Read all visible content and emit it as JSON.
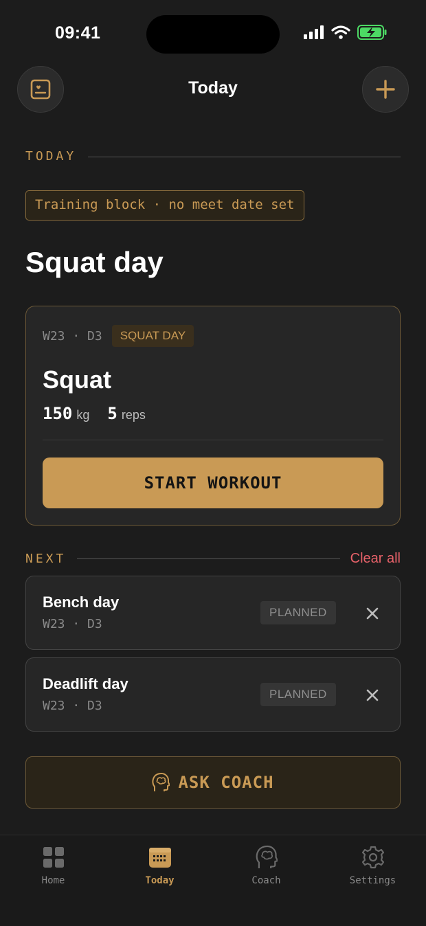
{
  "status_bar": {
    "time": "09:41"
  },
  "nav": {
    "title": "Today",
    "left_icon": "journal-icon",
    "right_icon": "plus-icon"
  },
  "today_section": {
    "label": "TODAY",
    "block_tag": "Training block · no meet date set",
    "day_title": "Squat day"
  },
  "workout_card": {
    "meta": "W23 · D3",
    "badge": "SQUAT DAY",
    "lift": "Squat",
    "weight": "150",
    "weight_unit": "kg",
    "reps": "5",
    "reps_unit": "reps",
    "start_label": "START WORKOUT"
  },
  "next_section": {
    "label": "NEXT",
    "clear_label": "Clear all",
    "items": [
      {
        "name": "Bench day",
        "meta": "W23 · D3",
        "status": "PLANNED"
      },
      {
        "name": "Deadlift day",
        "meta": "W23 · D3",
        "status": "PLANNED"
      }
    ]
  },
  "coach_button": {
    "label": "ASK COACH",
    "icon": "brain-head-icon"
  },
  "tab_bar": {
    "tabs": [
      {
        "label": "Home",
        "icon": "grid-icon",
        "active": false
      },
      {
        "label": "Today",
        "icon": "calendar-icon",
        "active": true
      },
      {
        "label": "Coach",
        "icon": "brain-head-icon",
        "active": false
      },
      {
        "label": "Settings",
        "icon": "gear-icon",
        "active": false
      }
    ]
  },
  "colors": {
    "accent": "#c99a55",
    "background": "#1c1c1c",
    "card": "#262626",
    "danger": "#e8626a",
    "battery": "#4cd964"
  }
}
